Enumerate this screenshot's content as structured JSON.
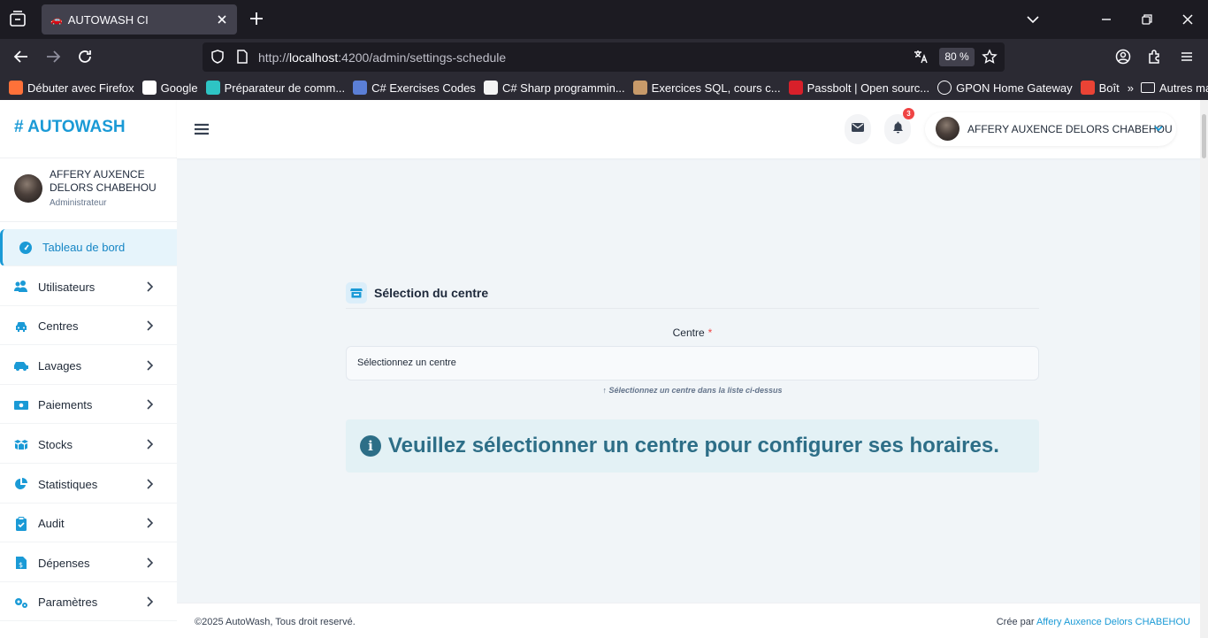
{
  "browser": {
    "tab_title": "AUTOWASH CI",
    "url_prefix": "http://",
    "url_host": "localhost",
    "url_path": ":4200/admin/settings-schedule",
    "zoom": "80 %",
    "bookmarks": [
      {
        "label": "Débuter avec Firefox",
        "color": "#ff7139"
      },
      {
        "label": "Google",
        "color": "#ffffff"
      },
      {
        "label": "Préparateur de comm...",
        "color": "#2ec4c4"
      },
      {
        "label": "C# Exercises Codes",
        "color": "#5b7fd6"
      },
      {
        "label": "C# Sharp programmin...",
        "color": "#f4f4f4"
      },
      {
        "label": "Exercices SQL, cours c...",
        "color": "#c79a6a"
      },
      {
        "label": "Passbolt | Open sourc...",
        "color": "#d8202a"
      },
      {
        "label": "GPON Home Gateway",
        "color": "#fbfbfe"
      },
      {
        "label": "Boît",
        "color": "#ea4335"
      }
    ],
    "other_bookmarks": "Autres marque-pages"
  },
  "sidebar": {
    "brand": "# AUTOWASH",
    "user_name": "AFFERY AUXENCE DELORS CHABEHOU",
    "user_role": "Administrateur",
    "items": [
      {
        "label": "Tableau de bord",
        "icon": "gauge-icon"
      },
      {
        "label": "Utilisateurs",
        "icon": "users-icon"
      },
      {
        "label": "Centres",
        "icon": "car-icon"
      },
      {
        "label": "Lavages",
        "icon": "car-wash-icon"
      },
      {
        "label": "Paiements",
        "icon": "money-icon"
      },
      {
        "label": "Stocks",
        "icon": "boxes-icon"
      },
      {
        "label": "Statistiques",
        "icon": "pie-chart-icon"
      },
      {
        "label": "Audit",
        "icon": "clipboard-check-icon"
      },
      {
        "label": "Dépenses",
        "icon": "invoice-icon"
      },
      {
        "label": "Paramètres",
        "icon": "gears-icon"
      }
    ]
  },
  "topbar": {
    "notification_count": "3",
    "user_name": "AFFERY AUXENCE DELORS CHABEHOU"
  },
  "main": {
    "section_title": "Sélection du centre",
    "field_label": "Centre",
    "required_mark": "*",
    "select_value": "Sélectionnez un centre",
    "hint": "Sélectionnez un centre dans la liste ci-dessus",
    "hint_arrow": "↑",
    "info_icon": "i",
    "info_message": "Veuillez sélectionner un centre pour configurer ses horaires."
  },
  "footer": {
    "copyright": "©2025 AutoWash, Tous droit reservé.",
    "credit_prefix": "Crée par",
    "credit_name": "Affery Auxence Delors CHABEHOU"
  },
  "colors": {
    "accent": "#1a9ad6",
    "info_text": "#2d6e87",
    "badge": "#ef4444"
  }
}
